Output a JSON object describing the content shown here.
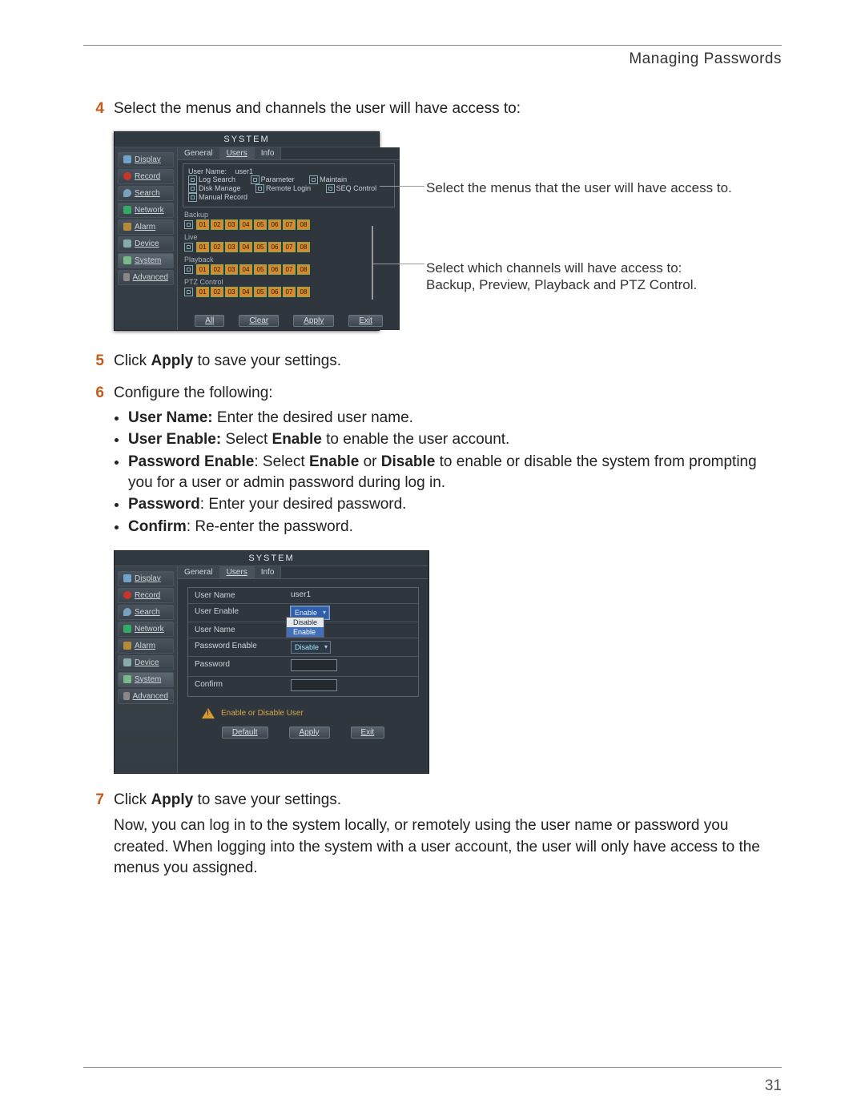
{
  "header": {
    "title": "Managing Passwords"
  },
  "page_number": "31",
  "steps": {
    "s4": {
      "num": "4",
      "text": "Select the menus and channels the user will have access to:"
    },
    "s5": {
      "num": "5",
      "pre": "Click ",
      "bold": "Apply",
      "post": " to save your settings."
    },
    "s6": {
      "num": "6",
      "text": "Configure the following:",
      "bul": {
        "b1_b": "User Name:",
        "b1_t": " Enter the desired user name.",
        "b2_b": "User Enable:",
        "b2_mid": " Select ",
        "b2_b2": "Enable",
        "b2_t": " to enable the user account.",
        "b3_b": "Password Enable",
        "b3_m1": ": Select ",
        "b3_b2": "Enable",
        "b3_m2": " or ",
        "b3_b3": "Disable",
        "b3_t": " to enable or disable the system from prompting you for a user or admin password during log in.",
        "b4_b": "Password",
        "b4_t": ": Enter your desired password.",
        "b5_b": "Confirm",
        "b5_t": ": Re-enter the password."
      }
    },
    "s7": {
      "num": "7",
      "pre": "Click ",
      "bold": "Apply",
      "post": " to save your settings.",
      "para": "Now, you can log in to the system locally, or remotely using the user name or password you created. When logging into the system with a user account, the user will only have access to the menus you assigned."
    }
  },
  "callouts": {
    "c1": "Select the menus that the user will have access to.",
    "c2a": "Select which channels will have access to:",
    "c2b": "Backup, Preview, Playback and PTZ Control."
  },
  "dvr": {
    "title": "SYSTEM",
    "sidebar": [
      "Display",
      "Record",
      "Search",
      "Network",
      "Alarm",
      "Device",
      "System",
      "Advanced"
    ],
    "tabs": [
      "General",
      "Users",
      "Info"
    ],
    "perm": {
      "username_label": "User Name:",
      "username_value": "user1",
      "row1": [
        "Log Search",
        "Parameter",
        "Maintain"
      ],
      "row2": [
        "Disk Manage",
        "Remote Login",
        "SEQ Control"
      ],
      "row3": [
        "Manual Record"
      ]
    },
    "sections": [
      "Backup",
      "Live",
      "Playback",
      "PTZ Control"
    ],
    "channels": [
      "01",
      "02",
      "03",
      "04",
      "05",
      "06",
      "07",
      "08"
    ],
    "buttons": [
      "All",
      "Clear",
      "Apply",
      "Exit"
    ]
  },
  "dvr2": {
    "title": "SYSTEM",
    "form": {
      "r1l": "User Name",
      "r1v": "user1",
      "r2l": "User Enable",
      "r2v": "Enable",
      "dd": [
        "Disable",
        "Enable"
      ],
      "r3l": "User Name",
      "r4l": "Password Enable",
      "r4v": "Disable",
      "r5l": "Password",
      "r6l": "Confirm"
    },
    "warn": "Enable or Disable User",
    "buttons": [
      "Default",
      "Apply",
      "Exit"
    ]
  }
}
